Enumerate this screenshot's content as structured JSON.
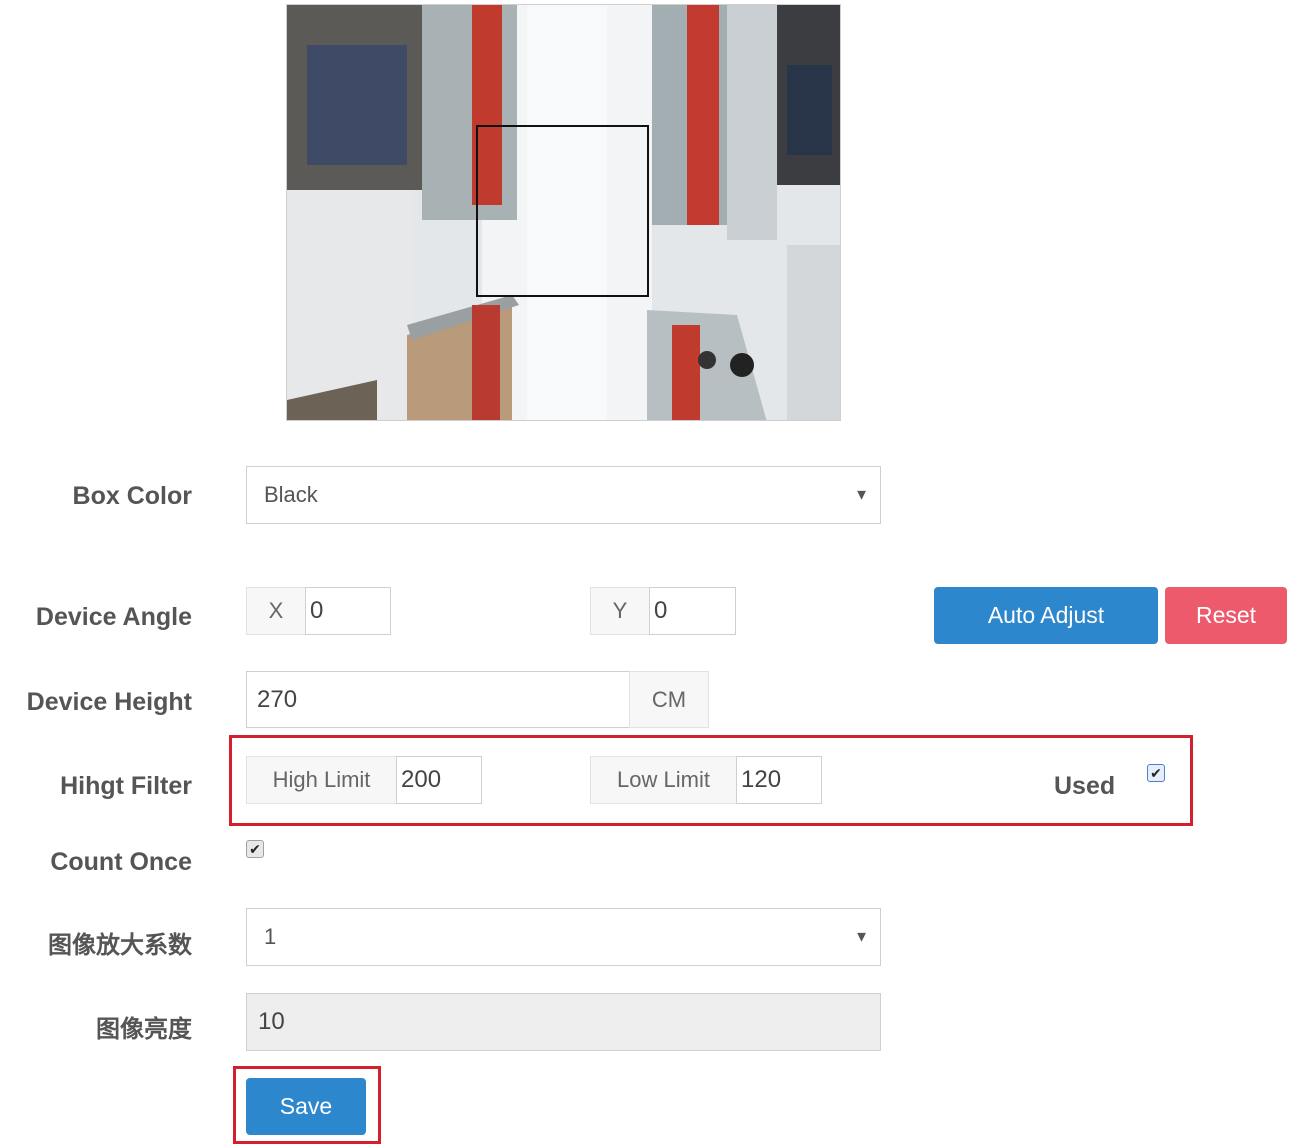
{
  "form": {
    "box_color": {
      "label": "Box Color",
      "value": "Black"
    },
    "device_angle": {
      "label": "Device Angle",
      "x_label": "X",
      "x_value": "0",
      "y_label": "Y",
      "y_value": "0"
    },
    "buttons": {
      "auto_adjust": "Auto Adjust",
      "reset": "Reset",
      "save": "Save"
    },
    "device_height": {
      "label": "Device Height",
      "value": "270",
      "unit": "CM"
    },
    "height_filter": {
      "label": "Hihgt Filter",
      "high_label": "High Limit",
      "high_value": "200",
      "low_label": "Low Limit",
      "low_value": "120",
      "used_label": "Used",
      "used_checked": true
    },
    "count_once": {
      "label": "Count Once",
      "checked": true
    },
    "zoom_factor": {
      "label": "图像放大系数",
      "value": "1"
    },
    "brightness": {
      "label": "图像亮度",
      "value": "10"
    }
  },
  "colors": {
    "primary": "#2d87cd",
    "danger": "#ec5a6b",
    "highlight": "#d3202c"
  }
}
